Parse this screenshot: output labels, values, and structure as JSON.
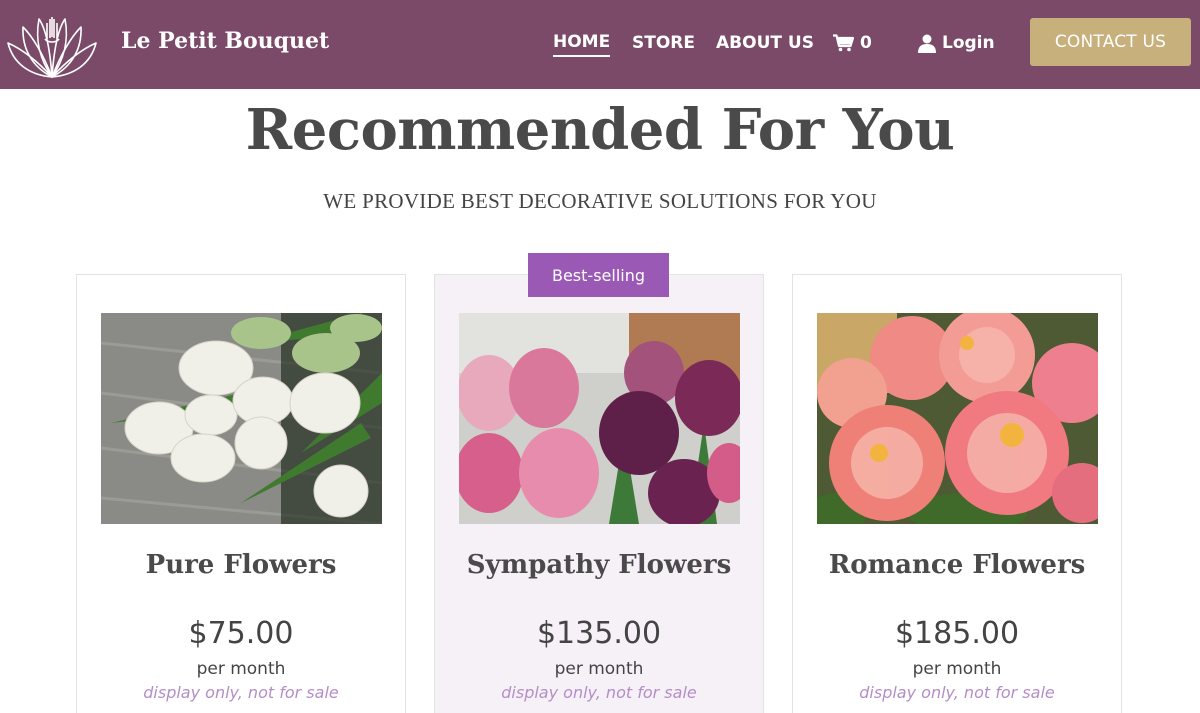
{
  "header": {
    "brand": "Le Petit Bouquet",
    "nav": {
      "home": "HOME",
      "store": "STORE",
      "about": "ABOUT US",
      "cart_count": "0",
      "login": "Login"
    },
    "contact_label": "CONTACT US",
    "icons": {
      "logo": "lotus-logo-icon",
      "cart": "cart-icon",
      "login": "user-icon"
    }
  },
  "main": {
    "title": "Recommended For You",
    "subtitle": "WE PROVIDE BEST DECORATIVE SOLUTIONS FOR YOU",
    "badge": "Best-selling",
    "cards": [
      {
        "title": "Pure Flowers",
        "price": "$75.00",
        "period": "per month",
        "note": "display only, not for sale",
        "image": "white-tulips-image"
      },
      {
        "title": "Sympathy Flowers",
        "price": "$135.00",
        "period": "per month",
        "note": "display only, not for sale",
        "image": "pink-purple-tulips-image"
      },
      {
        "title": "Romance Flowers",
        "price": "$185.00",
        "period": "per month",
        "note": "display only, not for sale",
        "image": "coral-peonies-image"
      }
    ]
  },
  "colors": {
    "header_bg": "#7a4a68",
    "contact_bg": "#c7b07b",
    "badge_bg": "#9b59b6",
    "note_text": "#b48dc9",
    "featured_card_bg": "#f6f1f7"
  }
}
